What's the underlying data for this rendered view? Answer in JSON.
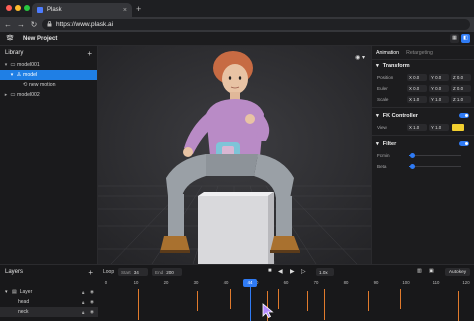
{
  "browser": {
    "tab_title": "Plask",
    "tab_close": "×",
    "new_tab": "+",
    "url": "https://www.plask.ai",
    "lock_icon": "lock-icon",
    "nav": {
      "back": "←",
      "forward": "→",
      "reload": "↻"
    },
    "traffic_lights": [
      "#ff5f57",
      "#febc2e",
      "#28c840"
    ]
  },
  "header": {
    "project_name": "New Project",
    "logo_icon": "plask-logo-icon",
    "right_buttons": [
      "grid-view-icon",
      "split-view-icon"
    ]
  },
  "library": {
    "title": "Library",
    "add": "+",
    "items": [
      {
        "label": "model001",
        "depth": 0,
        "icon": "folder-icon",
        "caret": "▾",
        "selected": false
      },
      {
        "label": "model",
        "depth": 1,
        "icon": "person-icon",
        "caret": "▾",
        "selected": true
      },
      {
        "label": "new motion",
        "depth": 2,
        "icon": "motion-icon",
        "caret": "",
        "selected": false
      },
      {
        "label": "model002",
        "depth": 0,
        "icon": "folder-icon",
        "caret": "▸",
        "selected": false
      }
    ]
  },
  "viewport": {
    "menu_icon": "eye-icon",
    "menu_caret": "▾"
  },
  "panel": {
    "tabs": [
      "Animation",
      "Retargeting"
    ],
    "transform": {
      "title": "Transform",
      "rows": [
        {
          "label": "Position",
          "values": [
            "X 0.0",
            "Y 0.0",
            "Z 0.0"
          ]
        },
        {
          "label": "Euler",
          "values": [
            "X 0.0",
            "Y 0.0",
            "Z 0.0"
          ]
        },
        {
          "label": "Scale",
          "values": [
            "X 1.0",
            "Y 1.0",
            "Z 1.0"
          ]
        }
      ]
    },
    "fk": {
      "title": "FK Controller",
      "view_label": "View",
      "view_values": [
        "X 1.0",
        "Y 1.0"
      ],
      "color": "#f2cf2f"
    },
    "filter": {
      "title": "Filter",
      "rows": [
        {
          "label": "Fcmin",
          "value": 0.05
        },
        {
          "label": "Beta",
          "value": 0.05
        }
      ]
    },
    "accent": "#2f7bf5"
  },
  "layers": {
    "title": "Layers",
    "add": "+",
    "rows": [
      {
        "label": "Layer",
        "caret": "▾"
      },
      {
        "label": "head",
        "caret": ""
      },
      {
        "label": "neck",
        "caret": ""
      }
    ]
  },
  "timeline": {
    "loop_label": "Loop",
    "start_label": "Start",
    "start_value": "34",
    "end_label": "End",
    "end_value": "200",
    "speed": "1.0x",
    "autokey_label": "Autokey",
    "current_frame": "44",
    "ruler_labels": [
      "0",
      "10",
      "20",
      "30",
      "40",
      "50",
      "60",
      "70",
      "80",
      "90",
      "100",
      "110",
      "120"
    ],
    "keyframe_color": "#e07a2c"
  }
}
